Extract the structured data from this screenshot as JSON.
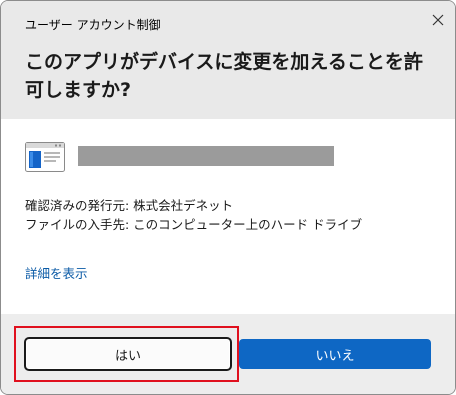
{
  "window": {
    "title": "ユーザー アカウント制御"
  },
  "header": {
    "question": "このアプリがデバイスに変更を加えることを許可しますか?"
  },
  "app": {
    "icon": "application-window-icon",
    "name": ""
  },
  "info": {
    "publisher": "確認済みの発行元: 株式会社デネット",
    "origin": "ファイルの入手先: このコンピューター上のハード ドライブ"
  },
  "links": {
    "details": "詳細を表示"
  },
  "buttons": {
    "yes": "はい",
    "no": "いいえ"
  },
  "colors": {
    "accent": "#0e67c4",
    "link": "#0a5aa6",
    "highlight": "#e0101e",
    "header_bg": "#e9e9e9",
    "footer_bg": "#ededed"
  }
}
